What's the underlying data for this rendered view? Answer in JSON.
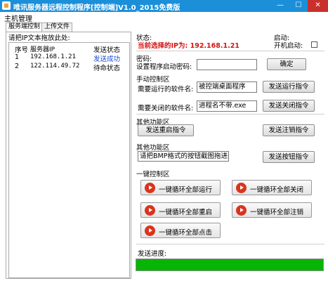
{
  "window": {
    "title": "唯讯服务器远程控制程序[控制端]V1.0_2015免费版",
    "minimize_glyph": "—",
    "maximize_glyph": "☐",
    "close_glyph": "✕"
  },
  "menu": {
    "main": "主机管理"
  },
  "tabs": [
    "服务端控制",
    "上传文件"
  ],
  "left": {
    "hint": "请把IP文本拖放此处:",
    "headers": [
      "序号",
      "服务器IP",
      "发送状态"
    ],
    "rows": [
      {
        "no": "1",
        "ip": "192.168.1.21",
        "status": "发送成功"
      },
      {
        "no": "2",
        "ip": "122.114.49.72",
        "status": "待命状态"
      }
    ]
  },
  "status": {
    "label": "状态:",
    "current_ip": "当前选择的IP为: 192.168.1.21",
    "startup_section": "启动:",
    "startup_label": "开机启动:"
  },
  "password": {
    "section": "密码:",
    "label": "设置程序启动密码:",
    "value": "",
    "confirm": "确定"
  },
  "manual": {
    "section": "手动控制区",
    "run_label": "需要运行的软件名:",
    "run_value": "被控端桌面程序",
    "run_button": "发送运行指令",
    "close_label": "需要关闭的软件名:",
    "close_value": "进程名不带.exe",
    "close_button": "发送关闭指令"
  },
  "other1": {
    "section": "其他功能区",
    "restart": "发送重启指令",
    "logout": "发送注销指令"
  },
  "other2": {
    "section": "其他功能区",
    "hint": "请把BMP格式的按钮截图拖进来",
    "send": "发送按钮指令"
  },
  "onekey": {
    "section": "一键控制区",
    "run_all": "一键循环全部运行",
    "close_all": "一键循环全部关闭",
    "restart_all": "一键循环全部重启",
    "logout_all": "一键循环全部注销",
    "click_all": "一键循环全部点击"
  },
  "progress": {
    "label": "发送进度:",
    "value": 1.0,
    "color": "#07b507"
  }
}
